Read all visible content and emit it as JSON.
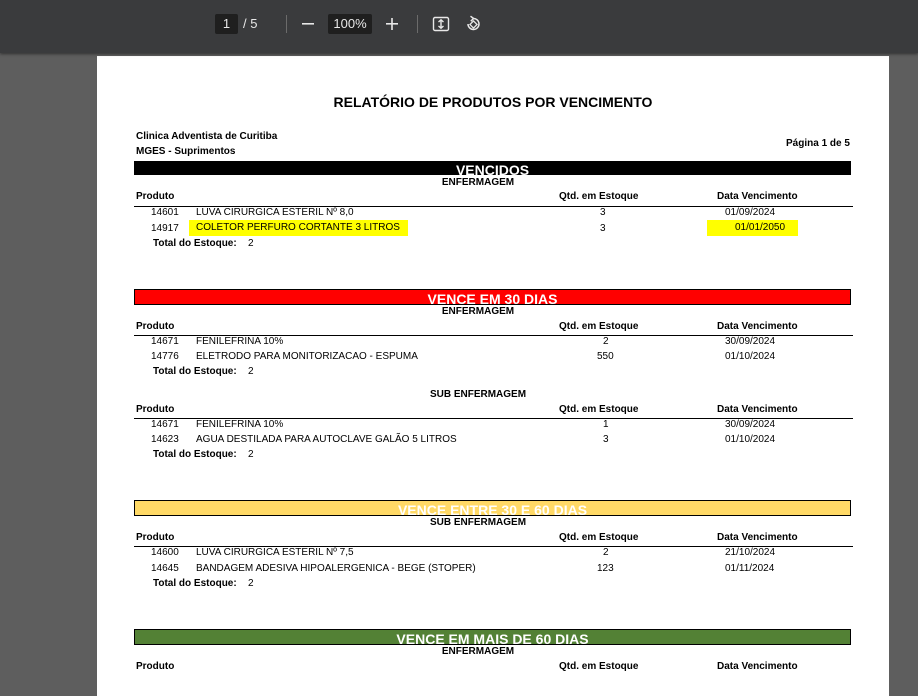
{
  "toolbar": {
    "page_current": "1",
    "page_total": "/ 5",
    "zoom": "100%",
    "icons": [
      "minus-icon",
      "plus-icon",
      "fit-page-icon",
      "rotate-icon"
    ]
  },
  "report": {
    "title": "RELATÓRIO DE PRODUTOS POR VENCIMENTO",
    "org": "Clinica Adventista de Curitiba",
    "dept": "MGES - Suprimentos",
    "page_label": "Página 1 de 5",
    "col_produto": "Produto",
    "col_qtd": "Qtd. em Estoque",
    "col_data": "Data Vencimento",
    "total_label": "Total do Estoque:",
    "sections": [
      {
        "title": "VENCIDOS",
        "color": "#000000",
        "groups": [
          {
            "name": "ENFERMAGEM",
            "rows": [
              {
                "code": "14601",
                "desc": "LUVA CIRURGICA ESTERIL Nº 8,0",
                "qty": "3",
                "date": "01/09/2024",
                "highlight": false
              },
              {
                "code": "14917",
                "desc": "COLETOR PERFURO CORTANTE 3 LITROS",
                "qty": "3",
                "date": "01/01/2050",
                "highlight": true
              }
            ],
            "total": "2"
          }
        ]
      },
      {
        "title": "VENCE EM 30 DIAS",
        "color": "#ff0000",
        "groups": [
          {
            "name": "ENFERMAGEM",
            "rows": [
              {
                "code": "14671",
                "desc": "FENILEFRINA 10%",
                "qty": "2",
                "date": "30/09/2024",
                "highlight": false
              },
              {
                "code": "14776",
                "desc": "ELETRODO PARA MONITORIZACAO - ESPUMA",
                "qty": "550",
                "date": "01/10/2024",
                "highlight": false
              }
            ],
            "total": "2"
          },
          {
            "name": "SUB ENFERMAGEM",
            "rows": [
              {
                "code": "14671",
                "desc": "FENILEFRINA 10%",
                "qty": "1",
                "date": "30/09/2024",
                "highlight": false
              },
              {
                "code": "14623",
                "desc": "AGUA DESTILADA PARA AUTOCLAVE GALÃO 5 LITROS",
                "qty": "3",
                "date": "01/10/2024",
                "highlight": false
              }
            ],
            "total": "2"
          }
        ]
      },
      {
        "title": "VENCE ENTRE 30 E 60 DIAS",
        "color": "#ffd966",
        "groups": [
          {
            "name": "SUB ENFERMAGEM",
            "rows": [
              {
                "code": "14600",
                "desc": "LUVA CIRURGICA ESTERIL Nº 7,5",
                "qty": "2",
                "date": "21/10/2024",
                "highlight": false
              },
              {
                "code": "14645",
                "desc": "BANDAGEM ADESIVA HIPOALERGENICA - BEGE (STOPER)",
                "qty": "123",
                "date": "01/11/2024",
                "highlight": false
              }
            ],
            "total": "2"
          }
        ]
      },
      {
        "title": "VENCE EM MAIS DE 60 DIAS",
        "color": "#538135",
        "groups": [
          {
            "name": "ENFERMAGEM",
            "rows": [],
            "total": ""
          }
        ]
      }
    ]
  }
}
